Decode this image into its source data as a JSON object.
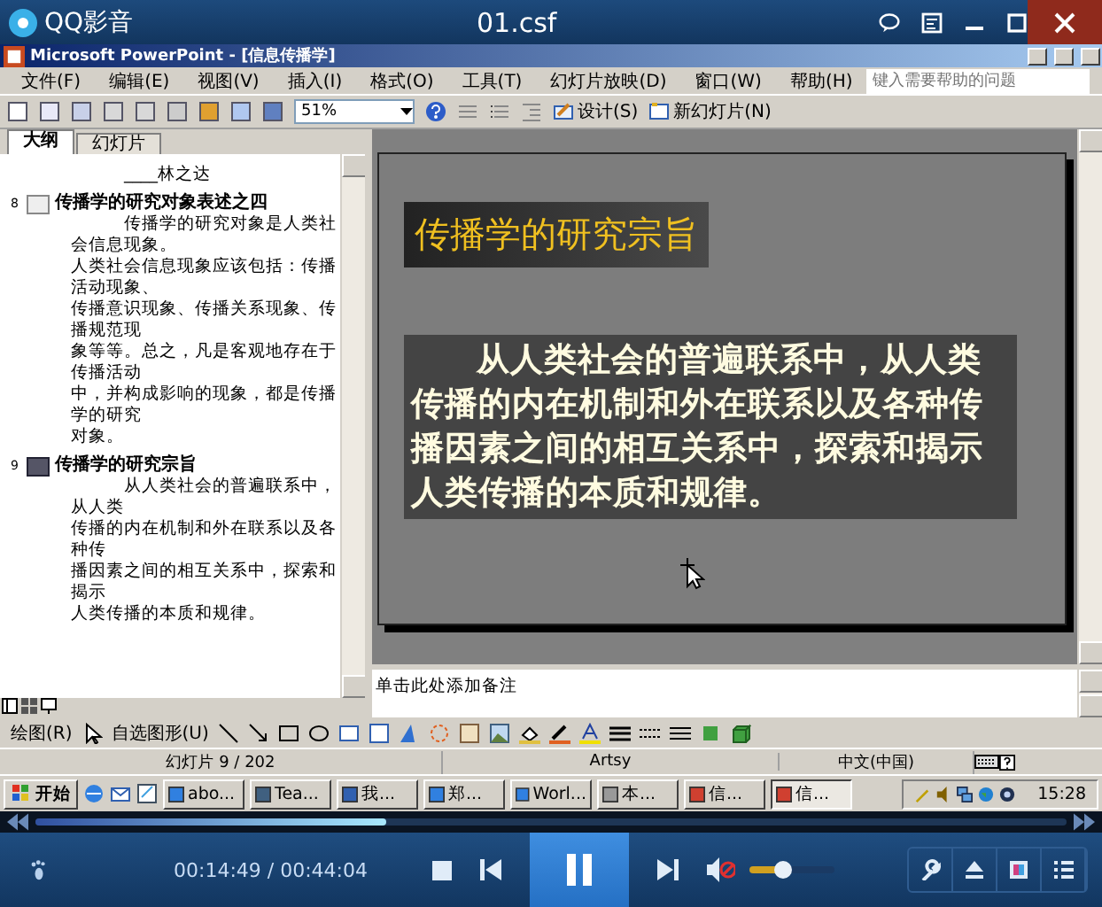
{
  "player": {
    "title": "QQ影音",
    "file": "01.csf"
  },
  "ppt": {
    "title": "Microsoft PowerPoint - [信息传播学]",
    "menus": [
      "文件(F)",
      "编辑(E)",
      "视图(V)",
      "插入(I)",
      "格式(O)",
      "工具(T)",
      "幻灯片放映(D)",
      "窗口(W)",
      "帮助(H)"
    ],
    "help_search": {
      "placeholder": "键入需要帮助的问题"
    },
    "zoom": "51%",
    "toolbar_buttons": [
      "设计(S)",
      "新幻灯片(N)"
    ],
    "pane_tabs": [
      {
        "label": "大纲",
        "selected": true
      },
      {
        "label": "幻灯片",
        "selected": false
      }
    ],
    "outline": [
      {
        "kind": "text",
        "paragraphs": [
          {
            "text": "____林之达",
            "indent": true
          }
        ]
      },
      {
        "kind": "slide",
        "number": "8",
        "title": "传播学的研究对象表述之四",
        "selected": false,
        "paragraphs": [
          {
            "text": "传播学的研究对象是人类社会信息现象。",
            "indent": true
          },
          {
            "text": "人类社会信息现象应该包括：传播活动现象、",
            "indent": false
          },
          {
            "text": "传播意识现象、传播关系现象、传播规范现",
            "indent": false
          },
          {
            "text": "象等等。总之，凡是客观地存在于传播活动",
            "indent": false
          },
          {
            "text": "中，并构成影响的现象，都是传播学的研究",
            "indent": false
          },
          {
            "text": "对象。",
            "indent": false
          }
        ]
      },
      {
        "kind": "slide",
        "number": "9",
        "title": "传播学的研究宗旨",
        "selected": true,
        "paragraphs": [
          {
            "text": "从人类社会的普遍联系中，从人类",
            "indent": true
          },
          {
            "text": "传播的内在机制和外在联系以及各种传",
            "indent": false
          },
          {
            "text": "播因素之间的相互关系中，探索和揭示",
            "indent": false
          },
          {
            "text": "人类传播的本质和规律。",
            "indent": false
          }
        ]
      }
    ],
    "slide": {
      "title": "传播学的研究宗旨",
      "body": "从人类社会的普遍联系中，从人类传播的内在机制和外在联系以及各种传播因素之间的相互关系中，探索和揭示人类传播的本质和规律。"
    },
    "notes": "单击此处添加备注",
    "drawing_menus": [
      "绘图(R)",
      "自选图形(U)"
    ],
    "status": [
      "幻灯片 9 / 202",
      "Artsy",
      "中文(中国)"
    ],
    "taskbar": {
      "start": "开始",
      "tasks": [
        {
          "label": "abo...",
          "selected": false
        },
        {
          "label": "Tea...",
          "selected": false
        },
        {
          "label": "我...",
          "selected": false
        },
        {
          "label": "郑...",
          "selected": false
        },
        {
          "label": "Worl...",
          "selected": false
        },
        {
          "label": "本...",
          "selected": false
        },
        {
          "label": "信...",
          "selected": false
        },
        {
          "label": "信...",
          "selected": true
        }
      ],
      "clock": "15:28"
    }
  },
  "controls": {
    "progress": {
      "level": 0.34
    },
    "time": "00:14:49 / 00:44:04",
    "volume": {
      "level": 0.4,
      "muted": true
    }
  }
}
